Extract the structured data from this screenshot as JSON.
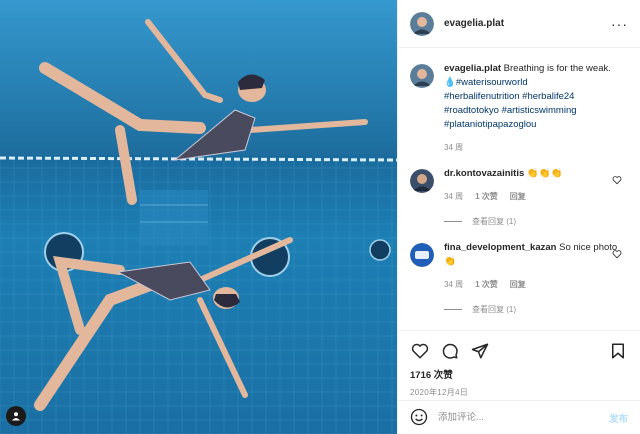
{
  "post": {
    "username": "evagelia.plat",
    "photo_alt": "evagelia.plat post photo"
  },
  "caption": {
    "username": "evagelia.plat",
    "text": "Breathing is for the weak.",
    "hashtag_first": "💧#waterisourworld",
    "hashtags": [
      "#herbalifenutrition #herbalife24",
      "#roadtotokyo #artisticswimming",
      "#plataniotipapazoglou"
    ],
    "time": "34 周"
  },
  "comments": [
    {
      "username": "dr.kontovazainitis",
      "text": "👏👏👏",
      "time": "34 周",
      "likes": "1 次赞",
      "reply": "回复",
      "view_replies": "查看回复 (1)"
    },
    {
      "username": "fina_development_kazan",
      "text": "So nice photo 👏",
      "time": "34 周",
      "likes": "1 次赞",
      "reply": "回复",
      "view_replies": "查看回复 (1)"
    }
  ],
  "actions": {
    "likes_count": "1716 次赞",
    "date": "2020年12月4日",
    "icons": [
      "heart-icon",
      "comment-icon",
      "share-icon",
      "bookmark-icon"
    ]
  },
  "comment_box": {
    "placeholder": "添加评论...",
    "post_label": "发布"
  },
  "colors": {
    "link": "#00376b",
    "secondary_text": "#8e8e8e",
    "post_disabled": "#b2dffc",
    "pool_blue": "#1b6fa0"
  }
}
